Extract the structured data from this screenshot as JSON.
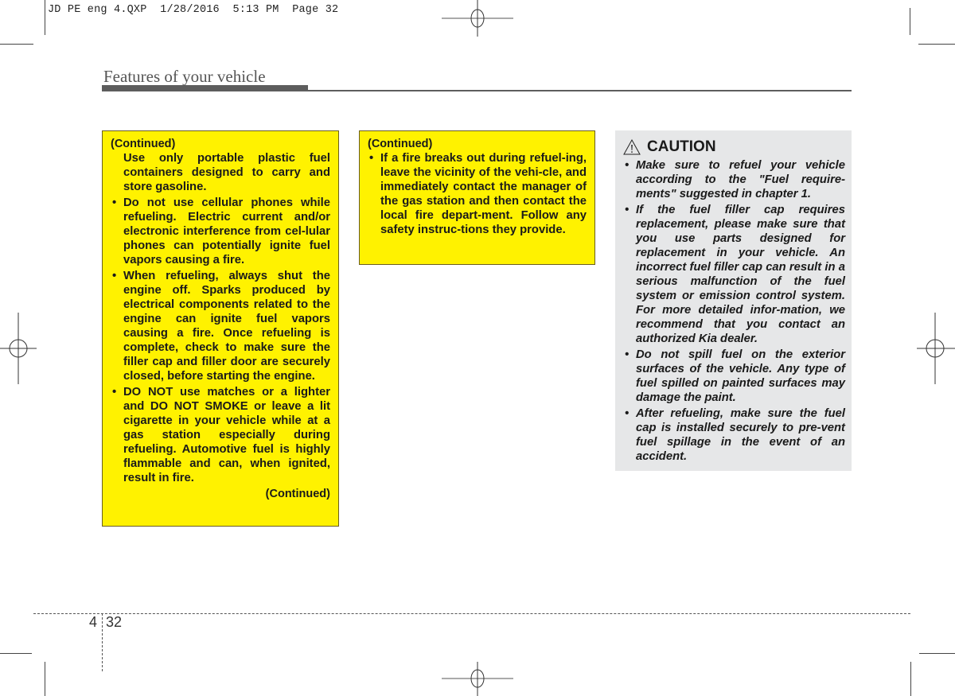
{
  "slug_line": {
    "file": "JD PE eng 4.QXP",
    "date": "1/28/2016",
    "time": "5:13 PM",
    "page": "Page 32"
  },
  "header": {
    "section_title": "Features of your vehicle"
  },
  "box_left": {
    "continued_top": "(Continued)",
    "intro_paragraph": "Use only portable plastic fuel containers designed to carry and store gasoline.",
    "bullets": [
      "Do not use cellular phones while refueling. Electric current and/or electronic interference from cel-lular phones can potentially ignite fuel vapors causing a fire.",
      "When refueling, always shut the engine off. Sparks produced by electrical components related to the engine can ignite fuel vapors causing a fire. Once refueling is complete, check to make sure the filler cap and filler door are securely closed, before starting the engine.",
      "DO NOT use matches or a lighter and DO NOT SMOKE or leave a lit cigarette in your vehicle while at a gas station especially during refueling. Automotive fuel is highly flammable and can, when ignited, result in fire."
    ],
    "continued_bottom": "(Continued)"
  },
  "box_middle": {
    "continued_top": "(Continued)",
    "bullets": [
      "If a fire breaks out during refuel-ing, leave the vicinity of the vehi-cle, and immediately contact the manager of the gas station and then contact the local fire depart-ment. Follow any safety instruc-tions they provide."
    ]
  },
  "caution_box": {
    "icon": "warning-triangle-icon",
    "title": "CAUTION",
    "bullets": [
      "Make sure to refuel your vehicle according to the \"Fuel require-ments\" suggested in chapter 1.",
      "If the fuel filler cap requires replacement, please make sure that you use parts designed for replacement in your vehicle. An incorrect fuel filler cap can result in a serious malfunction of the fuel system or emission control system. For more detailed infor-mation, we recommend that you contact an authorized Kia dealer.",
      "Do not spill fuel on the exterior surfaces of the vehicle. Any type of fuel spilled on painted surfaces may damage the paint.",
      "After refueling, make sure the fuel cap is installed securely to pre-vent fuel spillage in the event of an accident."
    ]
  },
  "footer": {
    "chapter": "4",
    "page": "32"
  },
  "colors": {
    "warning_yellow": "#fff200",
    "caution_gray": "#e6e7e8",
    "rule_gray": "#5d5d5d"
  }
}
